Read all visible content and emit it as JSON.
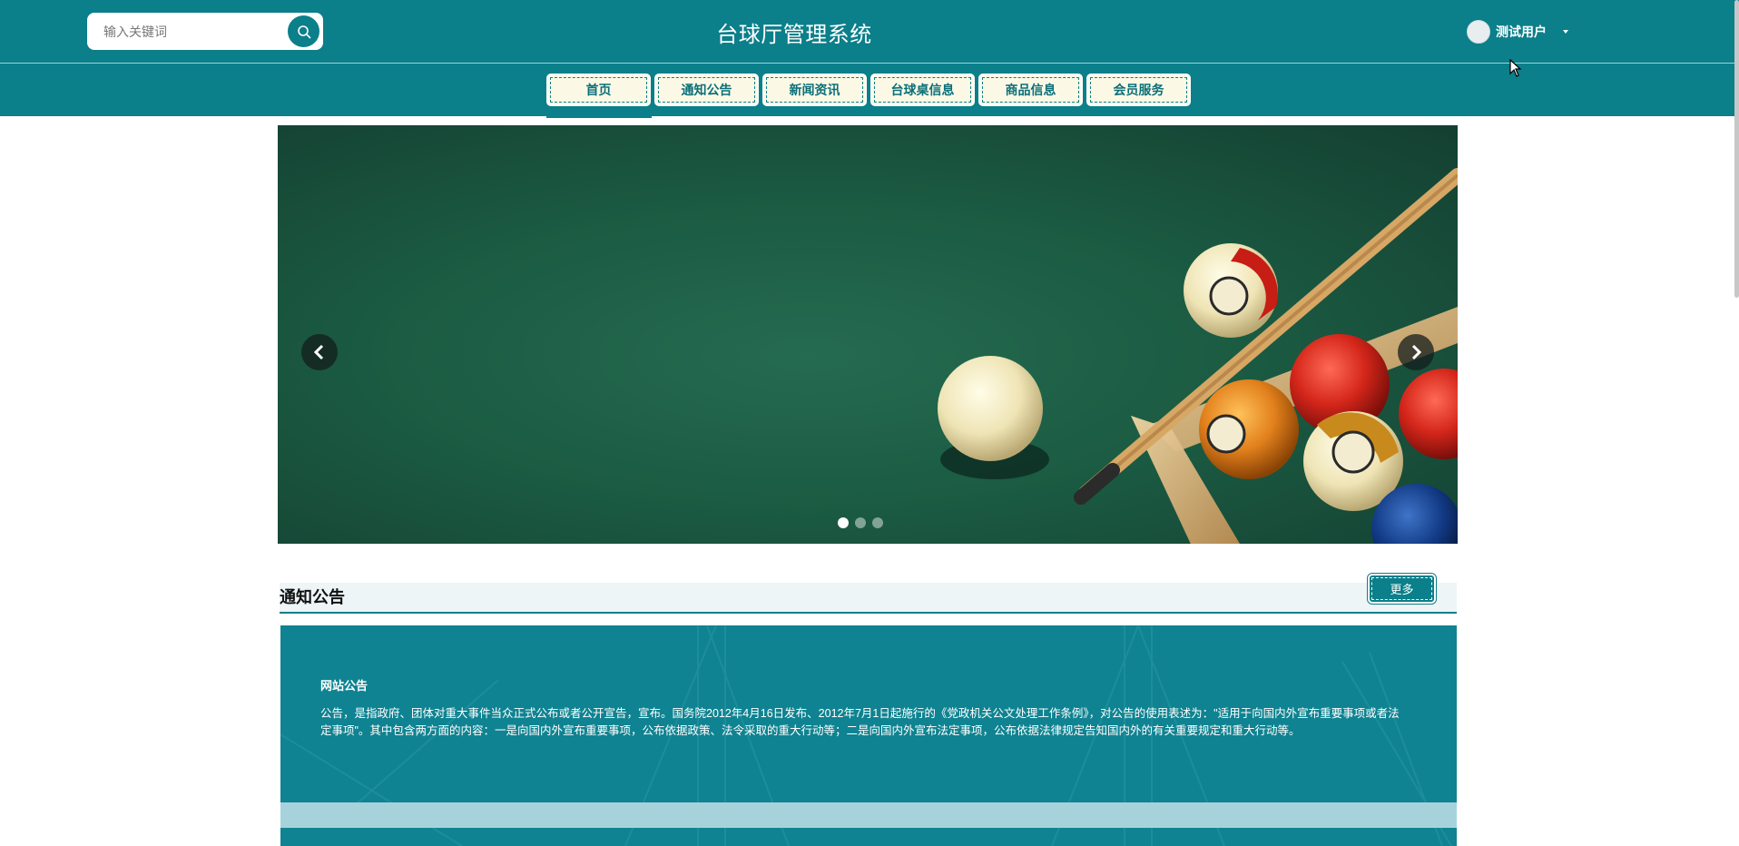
{
  "header": {
    "search_placeholder": "输入关键词",
    "site_title": "台球厅管理系统",
    "user_name": "测试用户"
  },
  "nav": {
    "items": [
      {
        "label": "首页",
        "active": true
      },
      {
        "label": "通知公告",
        "active": false
      },
      {
        "label": "新闻资讯",
        "active": false
      },
      {
        "label": "台球桌信息",
        "active": false
      },
      {
        "label": "商品信息",
        "active": false
      },
      {
        "label": "会员服务",
        "active": false
      }
    ]
  },
  "carousel": {
    "slide_count": 3,
    "active_index": 0,
    "prev_icon": "chevron-left-icon",
    "next_icon": "chevron-right-icon"
  },
  "notice": {
    "section_title": "通知公告",
    "more_label": "更多",
    "card_title": "网站公告",
    "card_text": "公告，是指政府、团体对重大事件当众正式公布或者公开宣告，宣布。国务院2012年4月16日发布、2012年7月1日起施行的《党政机关公文处理工作条例》，对公告的使用表述为：\"适用于向国内外宣布重要事项或者法定事项\"。其中包含两方面的内容：一是向国内外宣布重要事项，公布依据政策、法令采取的重大行动等；二是向国内外宣布法定事项，公布依据法律规定告知国内外的有关重要规定和重大行动等。"
  },
  "colors": {
    "primary": "#0b7f8a",
    "nav_bg": "#fbf9e6",
    "felt": "#1b5c43"
  }
}
